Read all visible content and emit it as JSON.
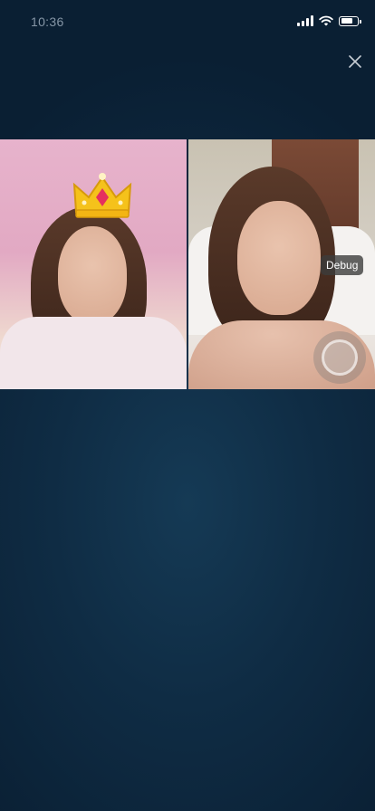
{
  "status_bar": {
    "time": "10:36",
    "signal_icon": "cellular-signal-icon",
    "wifi_icon": "wifi-icon",
    "battery_icon": "battery-icon",
    "battery_level": 0.8
  },
  "header": {
    "close_icon": "close-icon"
  },
  "video": {
    "left_filter_icon": "crown-filter-icon",
    "debug_label": "Debug",
    "capture_icon": "capture-button-icon"
  },
  "colors": {
    "background": "#0f2c44",
    "time_text": "#8696a6",
    "debug_badge": "#3c3c3c"
  }
}
